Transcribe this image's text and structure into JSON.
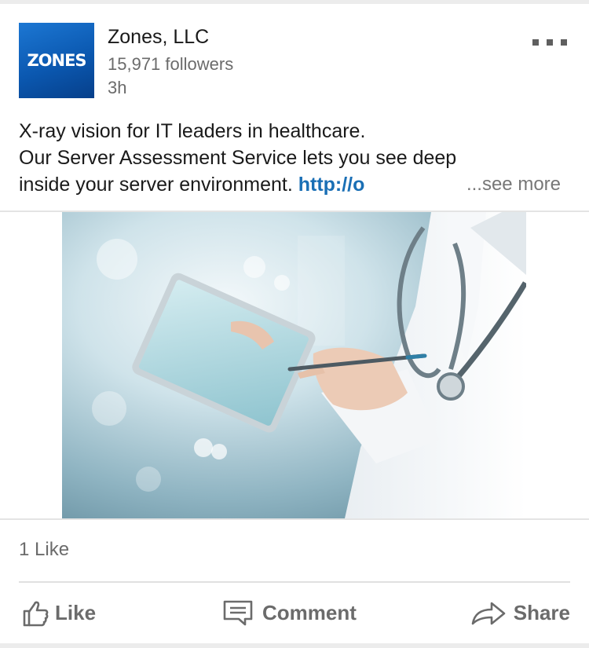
{
  "post": {
    "company_name": "Zones, LLC",
    "logo_text": "ZONES",
    "followers": "15,971 followers",
    "time": "3h",
    "text_line1": "X-ray vision for IT leaders in healthcare.",
    "text_line2": "Our Server Assessment Service lets you see deep",
    "text_line3": "inside your server environment. ",
    "link_text": "http://o",
    "see_more": "...see more"
  },
  "reactions": {
    "likes": "1 Like"
  },
  "actions": {
    "like": "Like",
    "comment": "Comment",
    "share": "Share"
  },
  "icons": {
    "menu": "more-horizontal-icon",
    "like": "thumbs-up-icon",
    "comment": "comment-bubble-icon",
    "share": "share-arrow-icon"
  },
  "colors": {
    "logo_blue": "#0b58b0",
    "link_blue": "#1a6fb5",
    "secondary_text": "#6b6b6b"
  }
}
